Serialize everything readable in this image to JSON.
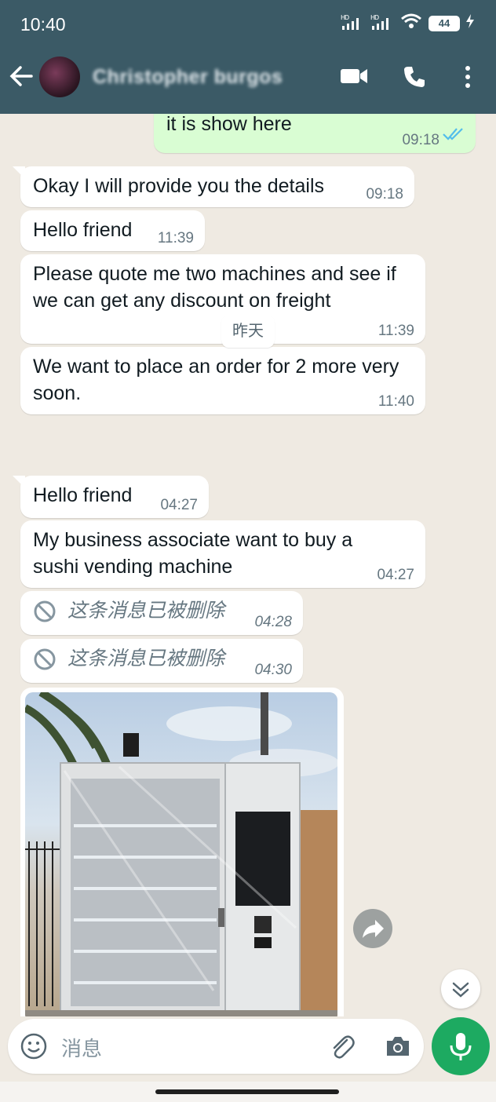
{
  "status_bar": {
    "time": "10:40",
    "signal1": "HD",
    "signal2": "HD",
    "battery": "44"
  },
  "header": {
    "contact_name": "Christopher burgos",
    "icons": [
      "back-arrow-icon",
      "video-call-icon",
      "phone-icon",
      "more-vert-icon"
    ]
  },
  "messages": [
    {
      "dir": "out",
      "text": "it is show here",
      "time": "09:18",
      "read": true
    },
    {
      "dir": "in",
      "text": "Okay I will provide you the details",
      "time": "09:18"
    },
    {
      "dir": "in",
      "text": "Hello friend",
      "time": "11:39"
    },
    {
      "dir": "in",
      "text": "Please quote me two machines and see if we can get any discount on freight",
      "time": "11:39"
    },
    {
      "dir": "in",
      "text": "We want to place an order for 2 more very soon.",
      "time": "11:40"
    },
    {
      "dir": "in",
      "text": "Hello friend",
      "time": "04:27"
    },
    {
      "dir": "in",
      "text": "My business associate want to buy a sushi vending machine",
      "time": "04:27"
    },
    {
      "dir": "in",
      "deleted": true,
      "text": "这条消息已被删除",
      "time": "04:28"
    },
    {
      "dir": "in",
      "deleted": true,
      "text": "这条消息已被删除",
      "time": "04:30"
    }
  ],
  "date_divider": "昨天",
  "input": {
    "placeholder": "消息"
  },
  "colors": {
    "header_bg": "#3b5a66",
    "chat_bg": "#efeae2",
    "outgoing_bubble": "#d9fdd3",
    "incoming_bubble": "#ffffff",
    "read_tick": "#53bdeb",
    "mic_button": "#1daa61"
  }
}
